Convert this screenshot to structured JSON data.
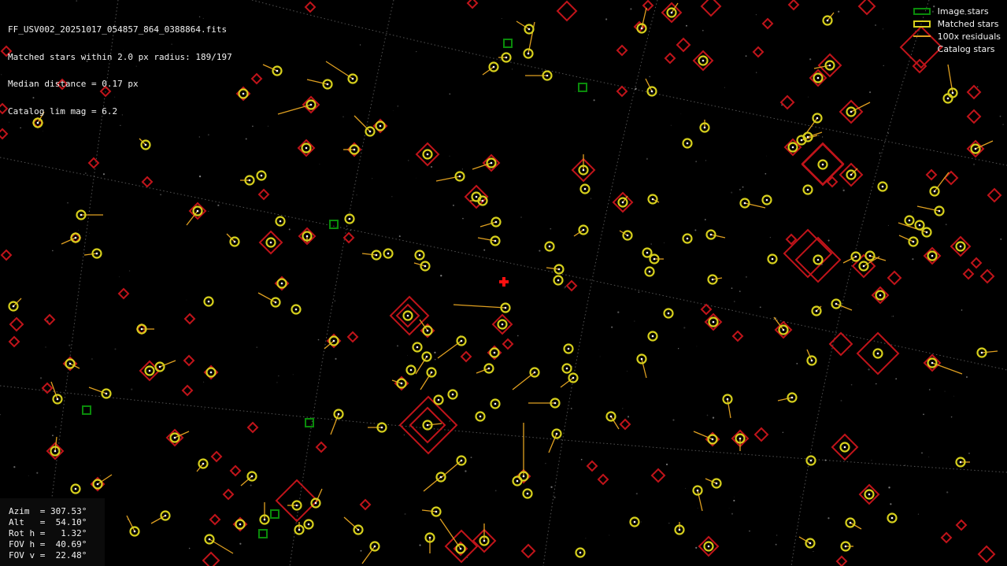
{
  "header": {
    "filename": "FF_USV002_20251017_054857_864_0388864.fits",
    "matched_line": "Matched stars within 2.0 px radius: 189/197",
    "median_line": "Median distance = 0.17 px",
    "limmag_line": "Catalog lim mag = 6.2"
  },
  "legend": {
    "items": [
      {
        "label": "Image stars",
        "color": "#0a8a0a",
        "kind": "box"
      },
      {
        "label": "Matched stars",
        "color": "#d6cf1c",
        "kind": "box"
      },
      {
        "label": "100x residuals",
        "color": "#e0a020",
        "kind": "line"
      },
      {
        "label": "Catalog stars",
        "color": "#c0141a",
        "kind": "none"
      }
    ]
  },
  "pointing": {
    "rows": [
      "Azim  = 307.53°",
      "Alt   =  54.10°",
      "Rot h =   1.32°",
      "FOV h =  40.69°",
      "FOV v =  22.48°"
    ]
  },
  "colors": {
    "catalog": "#c0141a",
    "matched": "#d6cf1c",
    "residual": "#e0a020",
    "image_star": "#0a8a0a",
    "center_mark": "#ff1010",
    "grid": "#8a8a8a"
  }
}
